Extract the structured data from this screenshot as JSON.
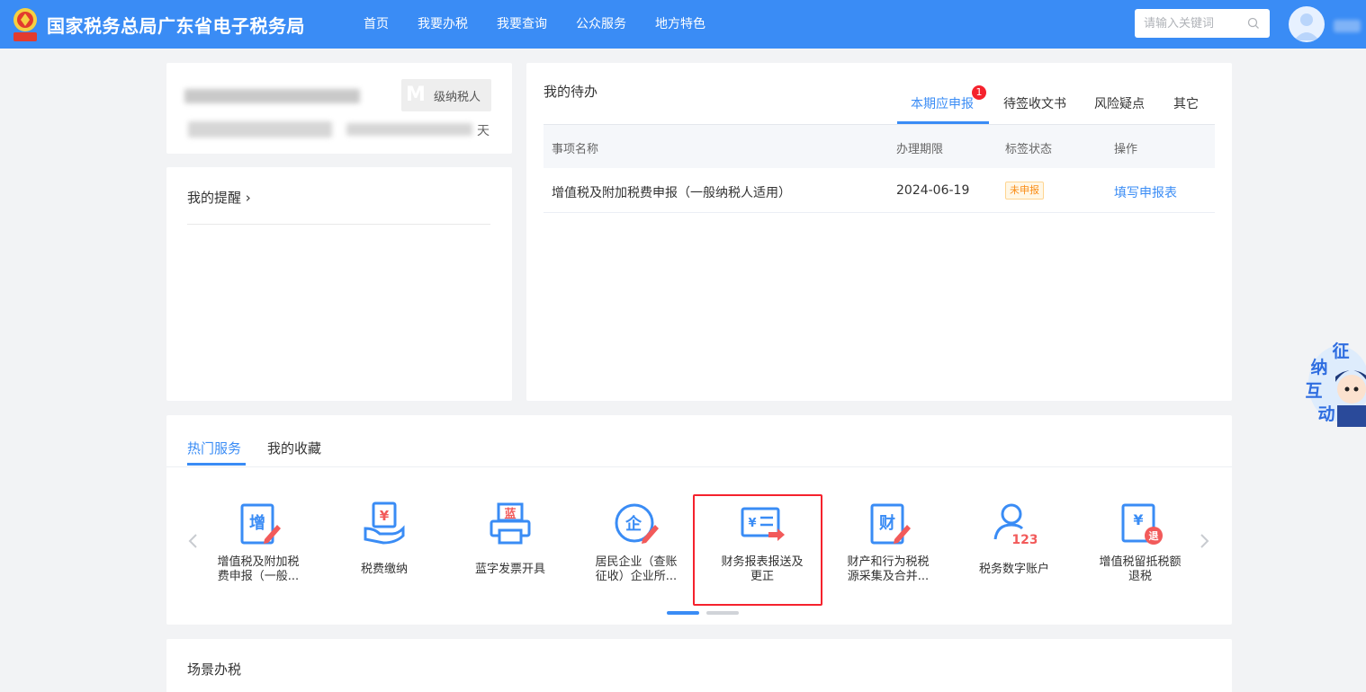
{
  "header": {
    "site_title": "国家税务总局广东省电子税务局",
    "nav": [
      "首页",
      "我要办税",
      "我要查询",
      "公众服务",
      "地方特色"
    ],
    "search_placeholder": "请输入关键词"
  },
  "profile": {
    "taxpayer_level_letter": "M",
    "taxpayer_level": "级纳税人",
    "days_unit": "天"
  },
  "reminder": {
    "title": "我的提醒 ›"
  },
  "todo": {
    "title": "我的待办",
    "tabs": [
      "本期应申报",
      "待签收文书",
      "风险疑点",
      "其它"
    ],
    "badge_count": "1",
    "columns": [
      "事项名称",
      "办理期限",
      "标签状态",
      "操作"
    ],
    "rows": [
      {
        "name": "增值税及附加税费申报（一般纳税人适用）",
        "deadline": "2024-06-19",
        "status": "未申报",
        "action": "填写申报表"
      }
    ]
  },
  "services": {
    "tabs": [
      "热门服务",
      "我的收藏"
    ],
    "items": [
      {
        "line1": "增值税及附加税",
        "line2": "费申报（一般...",
        "icon": "vat-declare-icon"
      },
      {
        "line1": "税费缴纳",
        "line2": "",
        "icon": "tax-payment-icon"
      },
      {
        "line1": "蓝字发票开具",
        "line2": "",
        "icon": "invoice-printer-icon"
      },
      {
        "line1": "居民企业（查账",
        "line2": "征收）企业所...",
        "icon": "enterprise-tax-icon"
      },
      {
        "line1": "财务报表报送及",
        "line2": "更正",
        "icon": "financial-report-icon"
      },
      {
        "line1": "财产和行为税税",
        "line2": "源采集及合并...",
        "icon": "property-tax-icon"
      },
      {
        "line1": "税务数字账户",
        "line2": "",
        "icon": "digital-account-icon"
      },
      {
        "line1": "增值税留抵税额",
        "line2": "退税",
        "icon": "vat-refund-icon"
      }
    ]
  },
  "scene": {
    "title": "场景办税"
  },
  "float_widget": {
    "chars": [
      "征",
      "纳",
      "互",
      "动"
    ]
  },
  "colors": {
    "primary": "#3a8cf5",
    "danger": "#f5222d",
    "warning": "#fa8c16",
    "icon_red": "#f25a5a"
  }
}
